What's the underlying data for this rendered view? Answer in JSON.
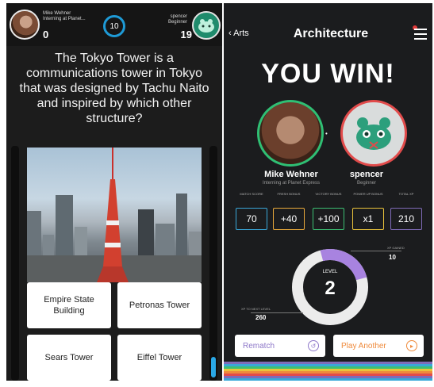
{
  "left": {
    "player_name": "Mike Wehner",
    "player_subtitle": "Interning at Planet...",
    "player_score": "0",
    "timer": "10",
    "opponent_name": "spencer",
    "opponent_subtitle": "Beginner",
    "opponent_score": "19",
    "question": "The Tokyo Tower is a communications tower in Tokyo that was designed by Tachu Naito and inspired by which other structure?",
    "answers": [
      "Empire State Building",
      "Petronas Tower",
      "Sears Tower",
      "Eiffel Tower"
    ]
  },
  "right": {
    "back_label": "Arts",
    "title": "Architecture",
    "result": "YOU WIN!",
    "player_name": "Mike Wehner",
    "player_subtitle": "Interning at Planet Express",
    "opponent_name": "spencer",
    "opponent_subtitle": "Beginner",
    "stats": [
      {
        "label": "MATCH SCORE",
        "value": "70",
        "color": "#39a7d8"
      },
      {
        "label": "FRESH BONUS",
        "value": "+40",
        "color": "#e9a93b"
      },
      {
        "label": "VICTORY BONUS",
        "value": "+100",
        "color": "#3cbf73"
      },
      {
        "label": "POWER UP BONUS",
        "value": "x1",
        "color": "#e9c23b"
      },
      {
        "label": "TOTAL XP",
        "value": "210",
        "color": "#7f6bb8"
      }
    ],
    "level_label": "LEVEL",
    "level": "2",
    "xp_gained_label": "XP GAINED",
    "xp_gained": "10",
    "xp_next_label": "XP TO NEXT LEVEL",
    "xp_next": "260",
    "rematch_label": "Rematch",
    "play_another_label": "Play Another"
  },
  "colors": {
    "win_green": "#2fbf74",
    "lose_red": "#e14b4b",
    "timer_blue": "#1e9ad6",
    "rematch_purple": "#8e78c9",
    "play_another_orange": "#ef8a3b"
  }
}
